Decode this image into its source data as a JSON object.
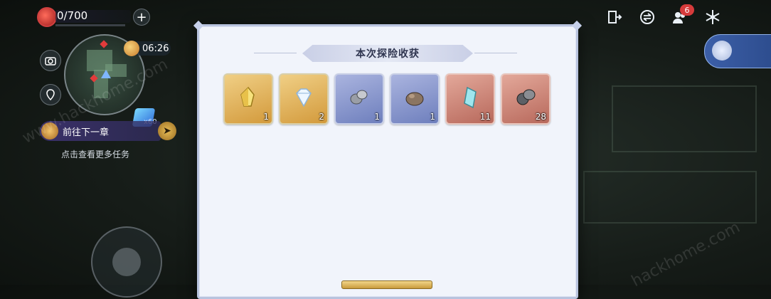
{
  "hud": {
    "resource_value": "0/700",
    "timer": "06:26",
    "quest_label": "前往下一章",
    "quest_hint": "点击查看更多任务",
    "crystal_count": "x60",
    "team_badge": "6"
  },
  "panel": {
    "title": "本次探险收获",
    "items": [
      {
        "name": "gold-crystal",
        "count": "1",
        "rarity": "gold"
      },
      {
        "name": "diamond",
        "count": "2",
        "rarity": "gold"
      },
      {
        "name": "silver-ore",
        "count": "1",
        "rarity": "purple"
      },
      {
        "name": "bronze-ore",
        "count": "1",
        "rarity": "purple"
      },
      {
        "name": "aqua-crystal",
        "count": "11",
        "rarity": "red"
      },
      {
        "name": "iron-ore",
        "count": "28",
        "rarity": "red"
      }
    ]
  },
  "watermark": [
    "www.hackhome.com",
    "hackhome.com"
  ],
  "colors": {
    "gold_card": "#e3b863",
    "purple_card": "#7f8fc6",
    "red_card": "#c98477",
    "panel_bg": "#f1f4fb"
  }
}
